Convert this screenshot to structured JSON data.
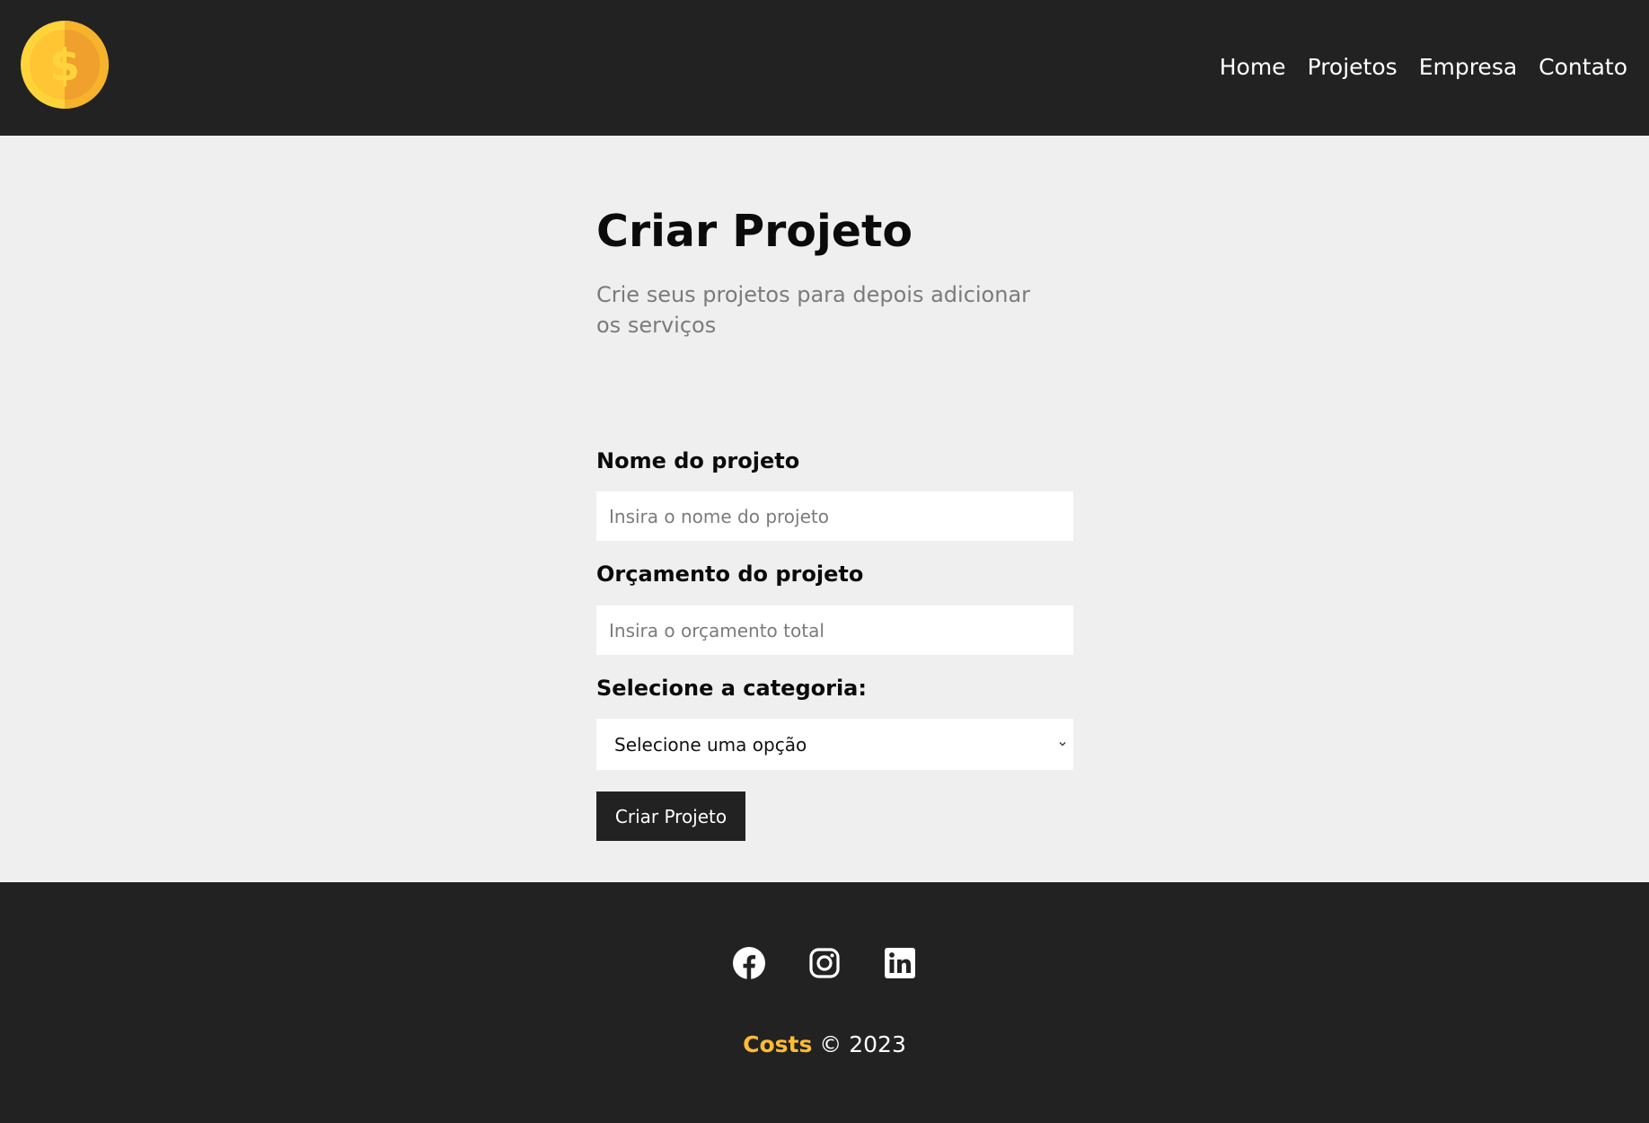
{
  "nav": {
    "logo_icon": "gold-coin-dollar-icon",
    "items": [
      {
        "label": "Home"
      },
      {
        "label": "Projetos"
      },
      {
        "label": "Empresa"
      },
      {
        "label": "Contato"
      }
    ]
  },
  "page": {
    "title": "Criar Projeto",
    "subtitle": "Crie seus projetos para depois adicionar os serviços"
  },
  "form": {
    "name_label": "Nome do projeto",
    "name_placeholder": "Insira o nome do projeto",
    "name_value": "",
    "budget_label": "Orçamento do projeto",
    "budget_placeholder": "Insira o orçamento total",
    "budget_value": "",
    "category_label": "Selecione a categoria:",
    "category_selected": "Selecione uma opção",
    "submit_label": "Criar Projeto"
  },
  "footer": {
    "social_icons": [
      "facebook-icon",
      "instagram-icon",
      "linkedin-icon"
    ],
    "brand": "Costs",
    "copyright": "© 2023"
  },
  "colors": {
    "dark": "#222222",
    "background": "#efefef",
    "accent": "#ffbb33",
    "coin_light": "#ffd43b",
    "coin_dark": "#f6a623"
  }
}
